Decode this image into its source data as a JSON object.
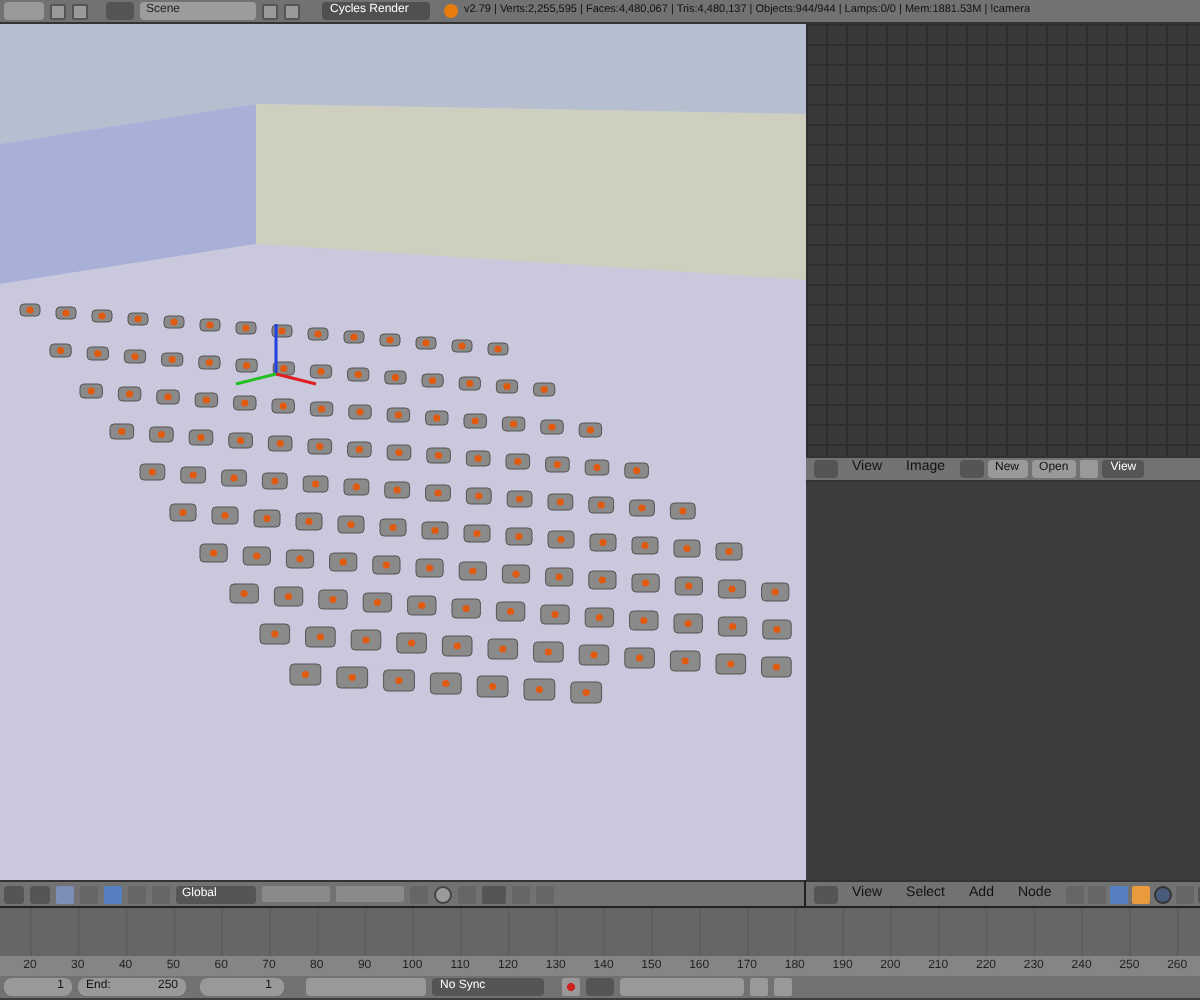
{
  "top_bar": {
    "scene": "Scene",
    "render_engine": "Cycles Render",
    "stats": "v2.79 | Verts:2,255,595 | Faces:4,480,067 | Tris:4,480,137 | Objects:944/944 | Lamps:0/0 | Mem:1881.53M | !camera"
  },
  "image_editor_header": {
    "menus": [
      "View",
      "Image"
    ],
    "new_button": "New",
    "open_button": "Open",
    "view_menu": "View"
  },
  "viewport_header": {
    "orientation": "Global"
  },
  "node_editor_header": {
    "menus": [
      "View",
      "Select",
      "Add",
      "Node"
    ]
  },
  "timeline": {
    "ruler": [
      "20",
      "30",
      "40",
      "50",
      "60",
      "70",
      "80",
      "90",
      "100",
      "110",
      "120",
      "130",
      "140",
      "150",
      "160",
      "170",
      "180",
      "190",
      "200",
      "210",
      "220",
      "230",
      "240",
      "250",
      "260"
    ],
    "start": "1",
    "end_label": "End:",
    "end": "250",
    "current": "1",
    "sync": "No Sync"
  }
}
